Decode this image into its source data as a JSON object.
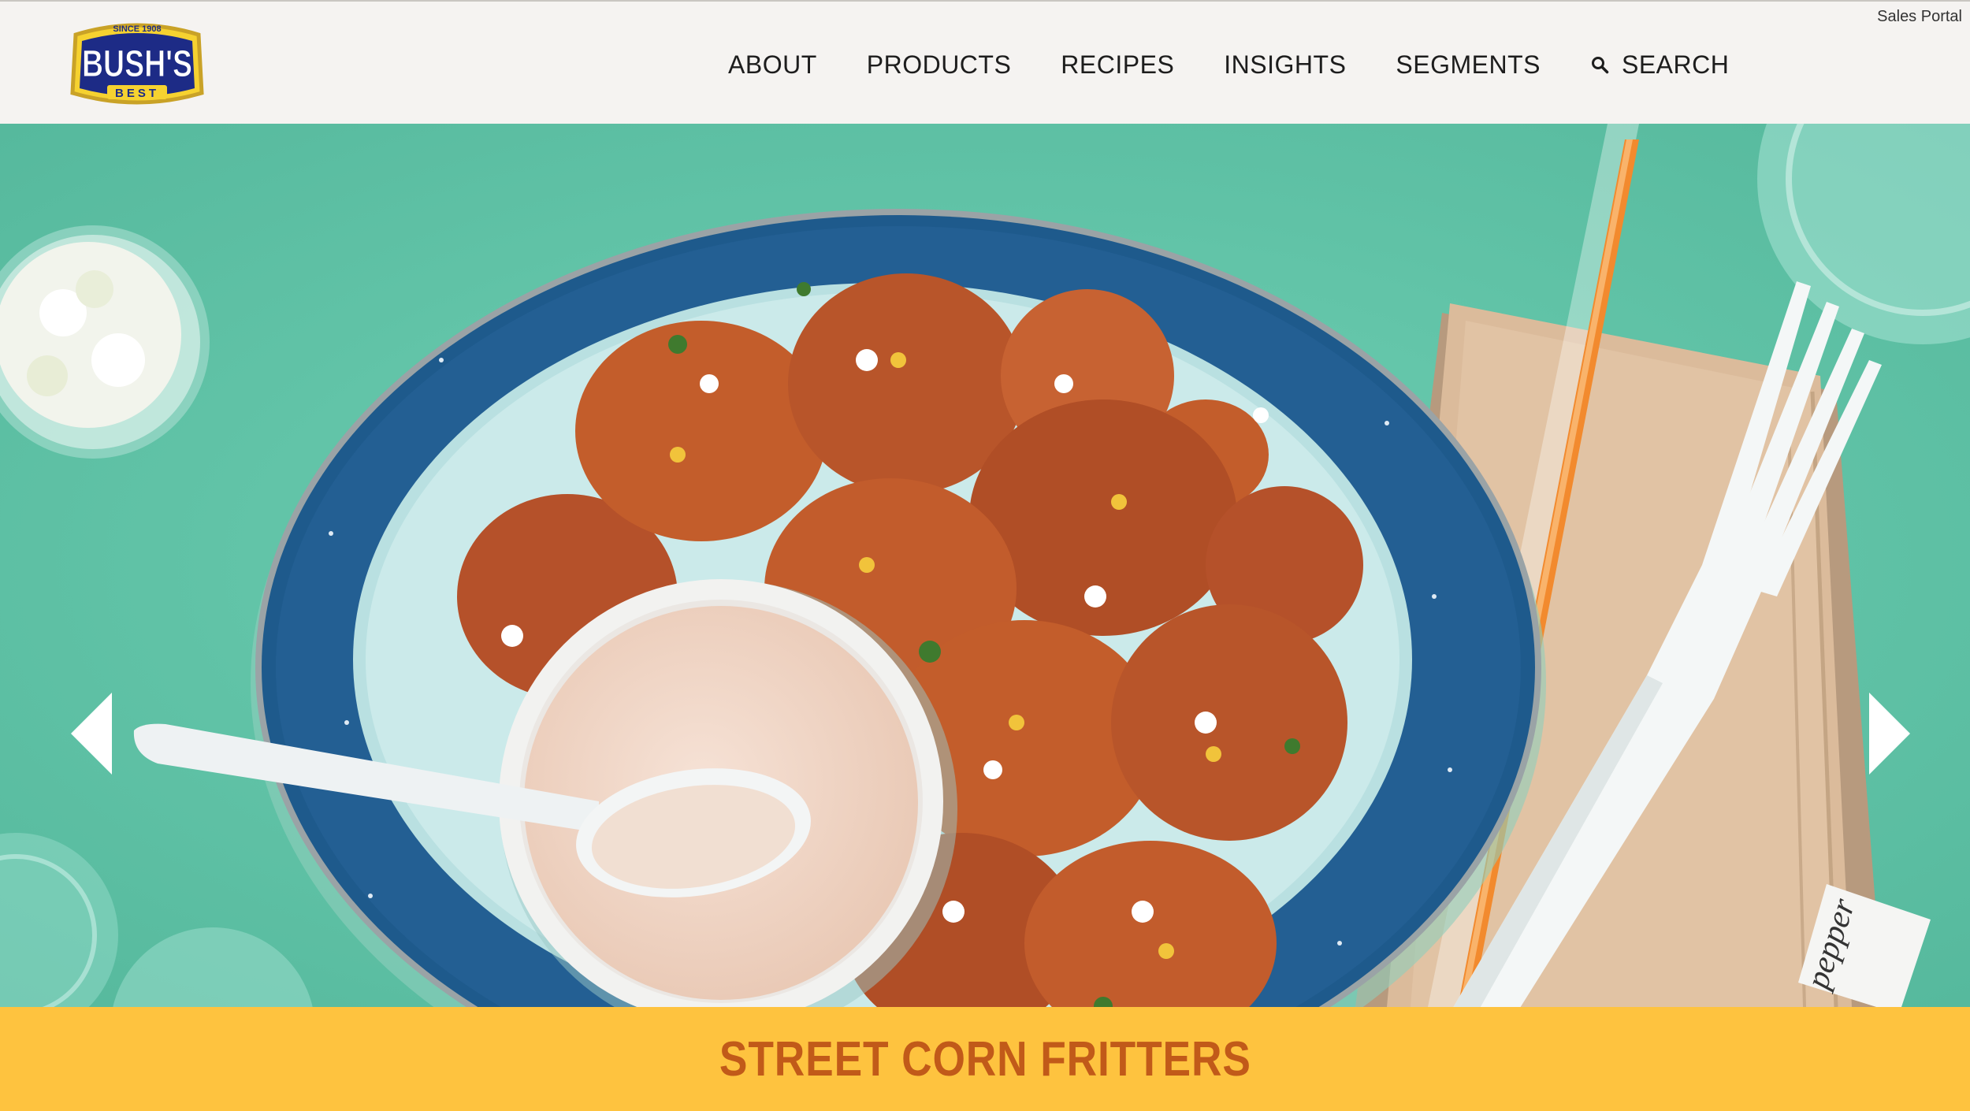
{
  "header": {
    "sales_portal": "Sales Portal",
    "logo": {
      "top_text": "SINCE 1908",
      "main_text": "BUSH'S",
      "bottom_text": "BEST",
      "colors": {
        "navy": "#1d2b86",
        "yellow": "#f6d230",
        "gold": "#c9a227"
      }
    },
    "nav": [
      {
        "label": "ABOUT"
      },
      {
        "label": "PRODUCTS"
      },
      {
        "label": "RECIPES"
      },
      {
        "label": "INSIGHTS"
      },
      {
        "label": "SEGMENTS"
      },
      {
        "label": "SEARCH",
        "icon": "search-icon"
      }
    ]
  },
  "hero": {
    "image": "street-corn-fritters-photo",
    "prev_icon": "arrow-left-icon",
    "next_icon": "arrow-right-icon",
    "packet_text": "pepper"
  },
  "caption": {
    "title": "STREET CORN FRITTERS",
    "colors": {
      "band": "#fec33f",
      "text": "#c15a19"
    }
  }
}
